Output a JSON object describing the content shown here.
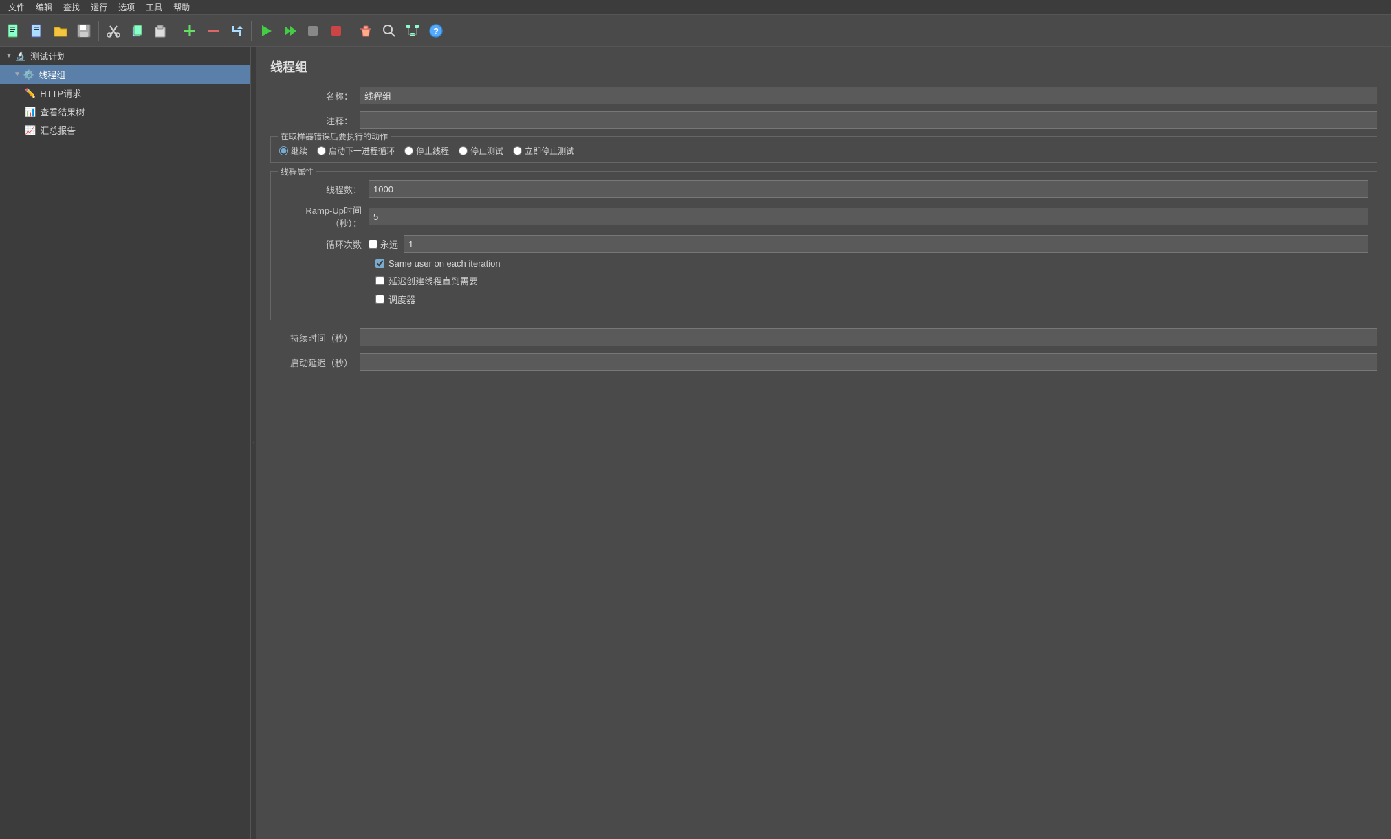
{
  "menubar": {
    "items": [
      "文件",
      "编辑",
      "查找",
      "运行",
      "选项",
      "工具",
      "帮助"
    ]
  },
  "toolbar": {
    "buttons": [
      {
        "name": "new-test-plan",
        "icon": "📄"
      },
      {
        "name": "new-template",
        "icon": "📋"
      },
      {
        "name": "open",
        "icon": "📂"
      },
      {
        "name": "save",
        "icon": "💾"
      },
      {
        "name": "cut",
        "icon": "✂️"
      },
      {
        "name": "copy",
        "icon": "📑"
      },
      {
        "name": "paste",
        "icon": "📋"
      },
      {
        "name": "add",
        "icon": "➕"
      },
      {
        "name": "remove",
        "icon": "➖"
      },
      {
        "name": "toggle",
        "icon": "⚡"
      },
      {
        "name": "run",
        "icon": "▶"
      },
      {
        "name": "run-no-pause",
        "icon": "⏩"
      },
      {
        "name": "stop",
        "icon": "⬛"
      },
      {
        "name": "stop-now",
        "icon": "🛑"
      },
      {
        "name": "clear",
        "icon": "🧹"
      },
      {
        "name": "search",
        "icon": "🔍"
      },
      {
        "name": "tree",
        "icon": "🌲"
      },
      {
        "name": "help",
        "icon": "❓"
      }
    ]
  },
  "sidebar": {
    "items": [
      {
        "id": "test-plan",
        "label": "测试计划",
        "level": 0,
        "arrow": "▼",
        "icon": "🔬",
        "selected": false
      },
      {
        "id": "thread-group",
        "label": "线程组",
        "level": 1,
        "arrow": "▼",
        "icon": "⚙️",
        "selected": true
      },
      {
        "id": "http-request",
        "label": "HTTP请求",
        "level": 2,
        "arrow": "",
        "icon": "✏️",
        "selected": false
      },
      {
        "id": "view-results-tree",
        "label": "查看结果树",
        "level": 2,
        "arrow": "",
        "icon": "📊",
        "selected": false
      },
      {
        "id": "summary-report",
        "label": "汇总报告",
        "level": 2,
        "arrow": "",
        "icon": "📈",
        "selected": false
      }
    ]
  },
  "content": {
    "title": "线程组",
    "name_label": "名称：",
    "name_value": "线程组",
    "comments_label": "注释：",
    "comments_value": "",
    "error_action": {
      "legend": "在取样器错误后要执行的动作",
      "options": [
        {
          "id": "continue",
          "label": "继续",
          "checked": true
        },
        {
          "id": "start-next",
          "label": "启动下一进程循环",
          "checked": false
        },
        {
          "id": "stop-thread",
          "label": "停止线程",
          "checked": false
        },
        {
          "id": "stop-test",
          "label": "停止测试",
          "checked": false
        },
        {
          "id": "stop-test-now",
          "label": "立即停止测试",
          "checked": false
        }
      ]
    },
    "thread_props": {
      "legend": "线程属性",
      "thread_count_label": "线程数：",
      "thread_count_value": "1000",
      "ramp_up_label": "Ramp-Up时间（秒）：",
      "ramp_up_value": "5",
      "loop_label": "循环次数",
      "loop_forever_label": "永远",
      "loop_forever_checked": false,
      "loop_value": "1",
      "same_user_label": "Same user on each iteration",
      "same_user_checked": true,
      "lazy_label": "延迟创建线程直到需要",
      "lazy_checked": false,
      "scheduler_label": "调度器",
      "scheduler_checked": false
    },
    "duration_label": "持续时间（秒）",
    "duration_value": "",
    "startup_delay_label": "启动延迟（秒）",
    "startup_delay_value": ""
  }
}
